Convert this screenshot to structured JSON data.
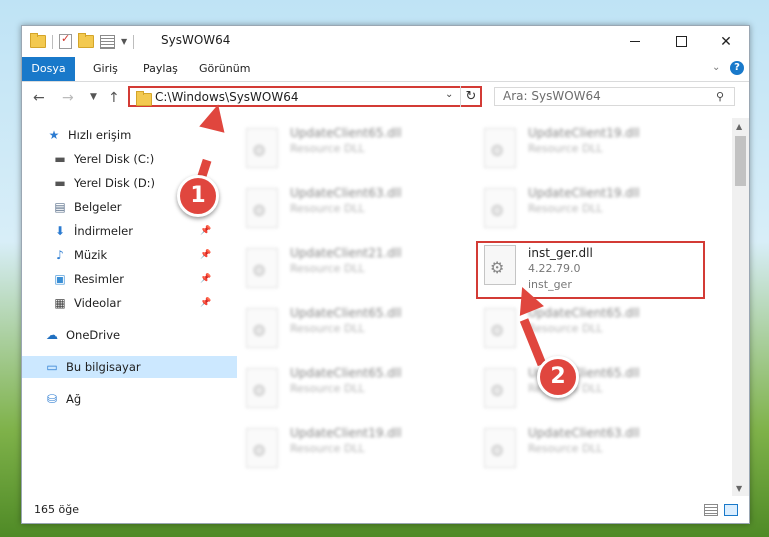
{
  "window": {
    "title": "SysWOW64"
  },
  "ribbon": {
    "tabs": [
      "Dosya",
      "Giriş",
      "Paylaş",
      "Görünüm"
    ]
  },
  "nav": {
    "address": "C:\\Windows\\SysWOW64",
    "search_placeholder": "Ara: SysWOW64"
  },
  "sidebar": {
    "items": [
      {
        "label": "Hızlı erişim",
        "icon": "star-icon"
      },
      {
        "label": "Yerel Disk (C:)",
        "icon": "drive-icon"
      },
      {
        "label": "Yerel Disk (D:)",
        "icon": "drive-icon"
      },
      {
        "label": "Belgeler",
        "icon": "document-icon"
      },
      {
        "label": "İndirmeler",
        "icon": "download-icon"
      },
      {
        "label": "Müzik",
        "icon": "music-icon"
      },
      {
        "label": "Resimler",
        "icon": "pictures-icon"
      },
      {
        "label": "Videolar",
        "icon": "video-icon"
      },
      {
        "label": "OneDrive",
        "icon": "cloud-icon"
      },
      {
        "label": "Bu bilgisayar",
        "icon": "computer-icon"
      },
      {
        "label": "Ağ",
        "icon": "network-icon"
      }
    ]
  },
  "files": [
    {
      "name": "UpdateClient65.dll",
      "desc": "Resource DLL"
    },
    {
      "name": "UpdateClient19.dll",
      "desc": "Resource DLL"
    },
    {
      "name": "UpdateClient63.dll",
      "desc": "Resource DLL"
    },
    {
      "name": "UpdateClient19.dll",
      "desc": "Resource DLL"
    },
    {
      "name": "UpdateClient21.dll",
      "desc": "Resource DLL"
    },
    {
      "name": "inst_ger.dll",
      "desc": "4.22.79.0",
      "desc2": "inst_ger"
    },
    {
      "name": "UpdateClient65.dll",
      "desc": "Resource DLL"
    },
    {
      "name": "UpdateClient65.dll",
      "desc": "Resource DLL"
    },
    {
      "name": "UpdateClient65.dll",
      "desc": "Resource DLL"
    },
    {
      "name": "UpdateClient65.dll",
      "desc": "Resource DLL"
    },
    {
      "name": "UpdateClient19.dll",
      "desc": "Resource DLL"
    },
    {
      "name": "UpdateClient63.dll",
      "desc": "Resource DLL"
    }
  ],
  "status": {
    "count": "165 öğe"
  },
  "annotations": {
    "step1": "1",
    "step2": "2"
  }
}
